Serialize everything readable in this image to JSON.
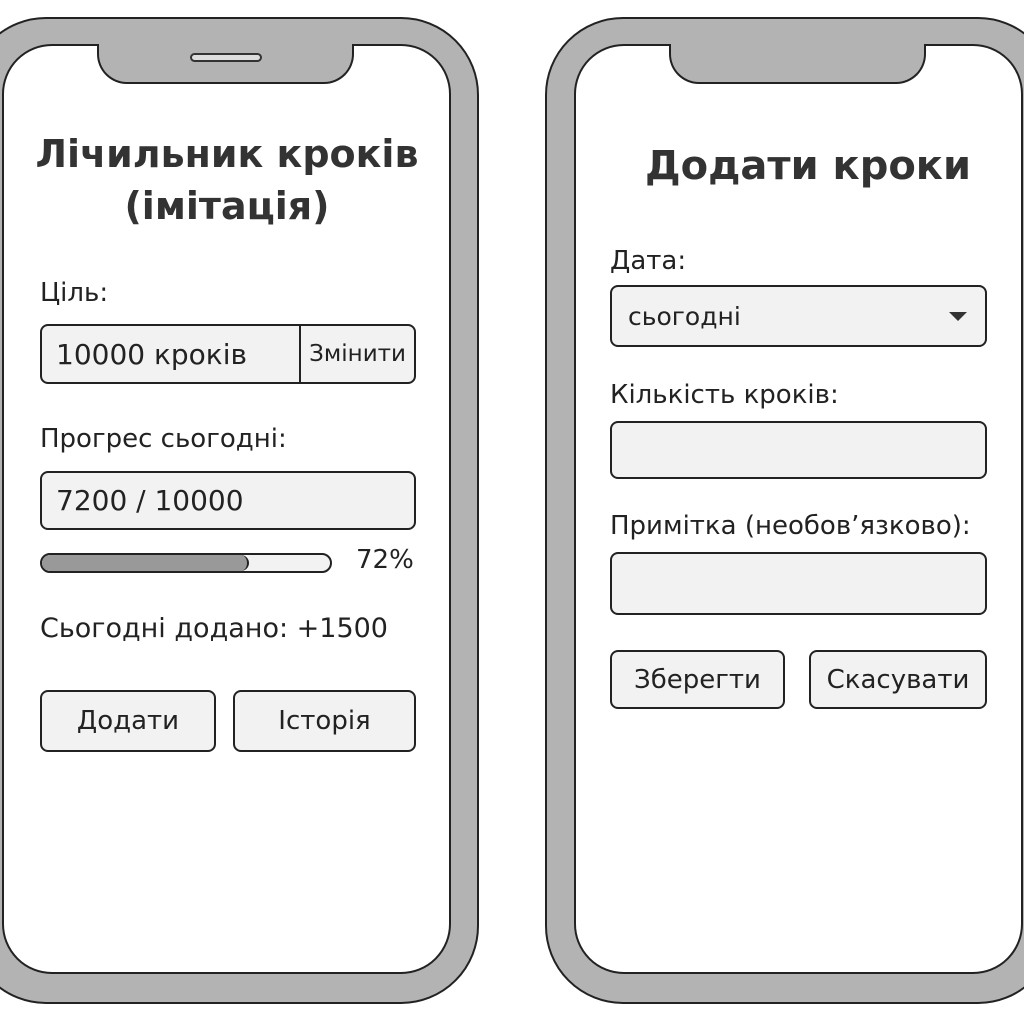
{
  "left_screen": {
    "title_line1": "Лічильник кроків",
    "title_line2": "(імітація)",
    "goal_label": "Ціль:",
    "goal_value": "10000 кроків",
    "change_button": "Змінити",
    "progress_label": "Прогрес сьогодні:",
    "progress_value": "7200 / 10000",
    "progress_fraction": 0.72,
    "progress_percent_text": "72%",
    "added_today": "Сьогодні додано: +1500",
    "add_button": "Додати",
    "history_button": "Історія"
  },
  "right_screen": {
    "title": "Додати кроки",
    "date_label": "Дата:",
    "date_selected": "сьогодні",
    "date_dropdown_icon": "caret-down-icon",
    "steps_label": "Кількість кроків:",
    "steps_value": "",
    "note_label": "Примітка (необов’язково):",
    "note_value": "",
    "save_button": "Зберегти",
    "cancel_button": "Скасувати"
  },
  "colors": {
    "frame": "#b3b3b3",
    "field": "#f2f2f2",
    "progress_fill": "#999999"
  }
}
